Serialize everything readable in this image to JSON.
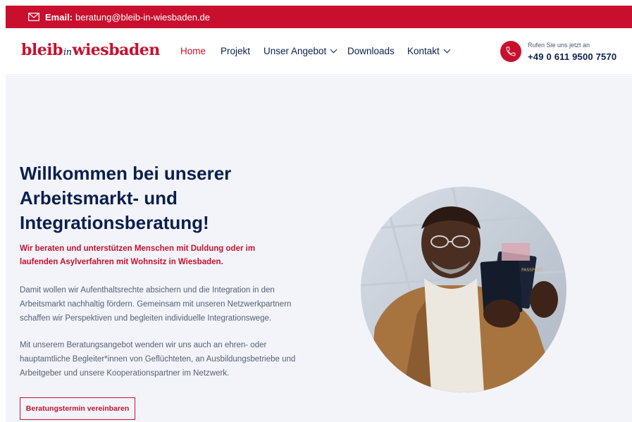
{
  "topbar": {
    "email_label": "Email:",
    "email_value": "beratung@bleib-in-wiesbaden.de"
  },
  "logo": {
    "part1": "bleib",
    "part2": "in",
    "part3": "wiesbaden"
  },
  "nav": {
    "items": [
      {
        "label": "Home",
        "active": true
      },
      {
        "label": "Projekt"
      },
      {
        "label": "Unser Angebot",
        "dropdown": true
      },
      {
        "label": "Downloads"
      },
      {
        "label": "Kontakt",
        "dropdown": true
      }
    ]
  },
  "contact": {
    "caption": "Rufen Sie uns jetzt an",
    "phone": "+49 0 611 9500 7570"
  },
  "hero": {
    "title": "Willkommen bei unserer Arbeitsmarkt- und Integrationsberatung!",
    "subtitle": "Wir beraten und unterstützen Menschen mit Duldung oder im laufenden Asylverfahren mit Wohnsitz in Wiesbaden.",
    "paragraph1": "Damit wollen wir Aufenthaltsrechte absichern und die Integration in den Arbeitsmarkt nachhaltig fördern. Gemeinsam mit unseren Netzwerkpartnern schaffen wir Perspektiven und begleiten individuelle Integrationswege.",
    "paragraph2": "Mit unserem Beratungsangebot wenden wir uns auch an ehren- oder hauptamtliche Begleiter*innen von Geflüchteten, an Ausbildungsbetriebe und Arbeitgeber und unsere Kooperationspartner im Netzwerk.",
    "cta": "Beratungstermin vereinbaren",
    "passport_text": "PASSPORT"
  },
  "colors": {
    "brand_red": "#c8102e",
    "navy": "#0b1f4d",
    "hero_bg": "#f2f4f9"
  },
  "icons": {
    "mail": "envelope-icon",
    "phone": "phone-icon",
    "dropdown": "chevron-down-icon"
  }
}
